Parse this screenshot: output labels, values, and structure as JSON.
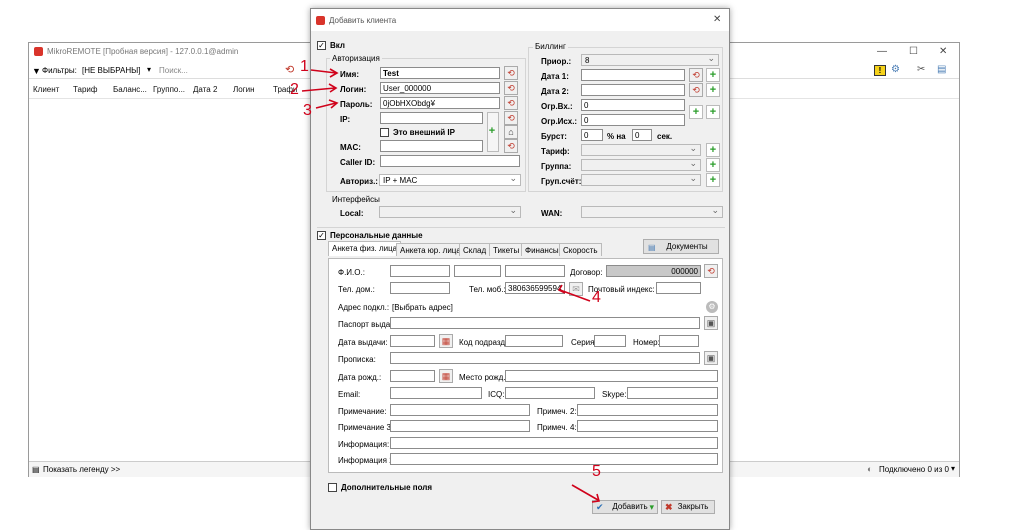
{
  "main_window": {
    "title": "MikroREMOTE [Пробная версия] - 127.0.0.1@admin",
    "filter_label": "Фильтры:",
    "filter_value": "[НЕ ВЫБРАНЫ]",
    "search_placeholder": "Поиск...",
    "columns": [
      "Клиент",
      "Тариф",
      "Баланс...",
      "Группо...",
      "Дата 2",
      "Логин",
      "Трафи"
    ],
    "legend_link": "Показать легенду >>",
    "connected_status": "Подключено 0 из 0"
  },
  "dialog": {
    "title": "Добавить клиента",
    "enabled_label": "Вкл",
    "auth_group": "Авторизация",
    "billing_group": "Биллинг",
    "interfaces_group": "Интерфейсы",
    "auth": {
      "name_label": "Имя:",
      "name_value": "Test",
      "login_label": "Логин:",
      "login_value": "User_000000",
      "password_label": "Пароль:",
      "password_value": "0jObHXObdg¥",
      "ip_label": "IP:",
      "external_ip_label": "Это внешний IP",
      "mac_label": "MAC:",
      "callerid_label": "Caller ID:",
      "authtype_label": "Авториз.:",
      "authtype_value": "IP + MAC"
    },
    "billing": {
      "prio_label": "Приор.:",
      "prio_value": "8",
      "date1_label": "Дата 1:",
      "date2_label": "Дата 2:",
      "limit_in_label": "Огр.Вх.:",
      "limit_in_value": "0",
      "limit_out_label": "Огр.Исх.:",
      "limit_out_value": "0",
      "burst_label": "Бурст:",
      "burst_value": "0",
      "percent_label": "% на",
      "sec_value": "0",
      "sec_label": "сек.",
      "tariff_label": "Тариф:",
      "group_label": "Группа:",
      "groupacc_label": "Груп.счёт:"
    },
    "interfaces": {
      "local_label": "Local:",
      "wan_label": "WAN:"
    },
    "personal_label": "Персональные данные",
    "tabs": [
      "Анкета физ. лица",
      "Анкета юр. лица",
      "Склад",
      "Тикеты",
      "Финансы",
      "Скорость"
    ],
    "documents_button": "Документы",
    "form": {
      "fio_label": "Ф.И.О.:",
      "contract_label": "Договор:",
      "contract_value": "000000",
      "phone_home_label": "Тел. дом.:",
      "phone_mob_label": "Тел. моб.:",
      "phone_mob_value": "380636599594",
      "postal_label": "Почтовый индекс:",
      "address_label": "Адрес подкл.:",
      "address_value": "[Выбрать адрес]",
      "passport_label": "Паспорт выдан:",
      "issue_date_label": "Дата выдачи:",
      "dept_code_label": "Код подразд.:",
      "series_label": "Серия:",
      "number_label": "Номер:",
      "registration_label": "Прописка:",
      "birth_date_label": "Дата рожд.:",
      "birth_place_label": "Место рожд.:",
      "email_label": "Email:",
      "icq_label": "ICQ:",
      "skype_label": "Skype:",
      "note_label": "Примечание:",
      "note2_label": "Примеч. 2:",
      "note3_label": "Примечание 3:",
      "note4_label": "Примеч. 4:",
      "info_label": "Информация:",
      "info2_label": "Информация 2:"
    },
    "extra_fields_label": "Дополнительные поля",
    "add_button": "Добавить",
    "close_button": "Закрыть"
  },
  "annotations": [
    "1",
    "2",
    "3",
    "4",
    "5"
  ],
  "colors": {
    "annotation": "#d0021b",
    "plus": "#2a9d2a",
    "refresh": "#c0392b"
  }
}
